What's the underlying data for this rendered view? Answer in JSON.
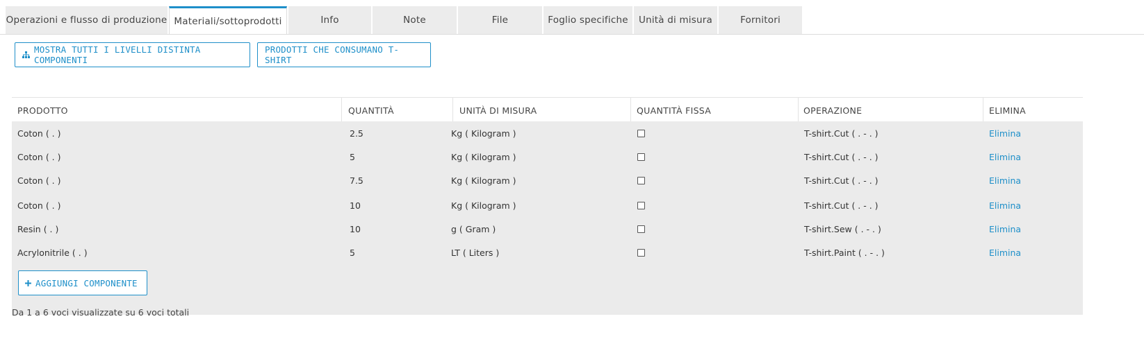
{
  "tabs": [
    {
      "label": "Operazioni e flusso di produzione",
      "active": false
    },
    {
      "label": "Materiali/sottoprodotti",
      "active": true
    },
    {
      "label": "Info",
      "active": false
    },
    {
      "label": "Note",
      "active": false
    },
    {
      "label": "File",
      "active": false
    },
    {
      "label": "Foglio specifiche",
      "active": false
    },
    {
      "label": "Unità di misura",
      "active": false
    },
    {
      "label": "Fornitori",
      "active": false
    }
  ],
  "toolbar": {
    "show_levels_label": "MOSTRA TUTTI I LIVELLI DISTINTA COMPONENTI",
    "consuming_products_label": "PRODOTTI CHE CONSUMANO T-SHIRT"
  },
  "table": {
    "headers": [
      "PRODOTTO",
      "QUANTITÀ",
      "UNITÀ DI MISURA",
      "QUANTITÀ FISSA",
      "OPERAZIONE",
      "ELIMINA"
    ],
    "rows": [
      {
        "prodotto": "Coton ( . )",
        "quantita": "2.5",
        "unita": "Kg ( Kilogram )",
        "fissa": false,
        "operazione": "T-shirt.Cut ( . - . )",
        "elimina": "Elimina"
      },
      {
        "prodotto": "Coton ( . )",
        "quantita": "5",
        "unita": "Kg ( Kilogram )",
        "fissa": false,
        "operazione": "T-shirt.Cut ( . - . )",
        "elimina": "Elimina"
      },
      {
        "prodotto": "Coton ( . )",
        "quantita": "7.5",
        "unita": "Kg ( Kilogram )",
        "fissa": false,
        "operazione": "T-shirt.Cut ( . - . )",
        "elimina": "Elimina"
      },
      {
        "prodotto": "Coton ( . )",
        "quantita": "10",
        "unita": "Kg ( Kilogram )",
        "fissa": false,
        "operazione": "T-shirt.Cut ( . - . )",
        "elimina": "Elimina"
      },
      {
        "prodotto": "Resin ( . )",
        "quantita": "10",
        "unita": "g ( Gram )",
        "fissa": false,
        "operazione": "T-shirt.Sew ( . - . )",
        "elimina": "Elimina"
      },
      {
        "prodotto": "Acrylonitrile ( . )",
        "quantita": "5",
        "unita": "LT ( Liters )",
        "fissa": false,
        "operazione": "T-shirt.Paint ( . - . )",
        "elimina": "Elimina"
      }
    ]
  },
  "add_component_label": "AGGIUNGI COMPONENTE",
  "footer_text": "Da 1 a 6 voci visualizzate su 6 voci totali",
  "colors": {
    "accent": "#1e8fc9",
    "table_bg": "#ebebeb"
  }
}
